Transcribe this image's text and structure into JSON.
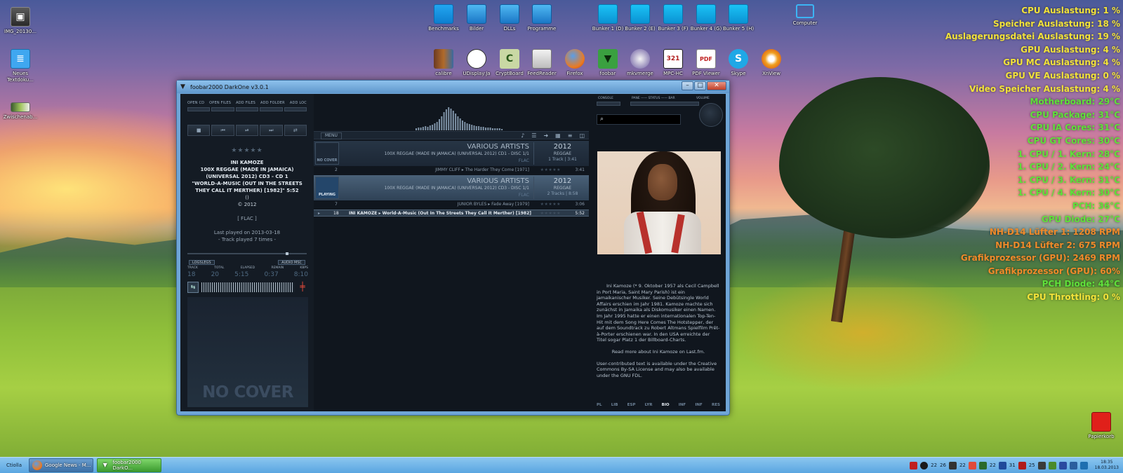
{
  "desktop": {
    "left_icons": [
      {
        "label": "IMG_20130...",
        "icon": "image-thumbnail-icon"
      },
      {
        "label": "Neues Textdoku...",
        "icon": "text-document-icon"
      },
      {
        "label": "Zwischenab...",
        "icon": "clipboard-icon"
      }
    ],
    "top_folders": [
      "Benchmarks",
      "Bilder",
      "DLLs",
      "Programme"
    ],
    "drives": [
      "Bunker 1 (D)",
      "Bunker 2 (E)",
      "Bunker 3 (F)",
      "Bunker 4 (G)",
      "Bunker 5 (H)"
    ],
    "computer": "Computer",
    "apps": [
      "calibre",
      "UDisplay:Ja",
      "CryptBoard",
      "FeedReader",
      "Firefox",
      "foobar",
      "mkvmerge",
      "MPC-HC",
      "PDF Viewer",
      "Skype",
      "XnView"
    ],
    "recycle_bin": "Papierkorb"
  },
  "sensors": [
    {
      "text": "CPU Auslastung: 1 %",
      "color": "#f2e23a"
    },
    {
      "text": "Speicher Auslastung: 18 %",
      "color": "#f2e23a"
    },
    {
      "text": "Auslagerungsdatei Auslastung: 19 %",
      "color": "#f2e23a"
    },
    {
      "text": "GPU Auslastung: 4 %",
      "color": "#f2e23a"
    },
    {
      "text": "GPU MC Auslastung: 4 %",
      "color": "#f2e23a"
    },
    {
      "text": "GPU VE Auslastung: 0 %",
      "color": "#f2e23a"
    },
    {
      "text": "Video Speicher Auslastung: 4 %",
      "color": "#f2e23a"
    },
    {
      "text": "Motherboard: 29°C",
      "color": "#5fe03a"
    },
    {
      "text": "CPU Package: 31°C",
      "color": "#5fe03a"
    },
    {
      "text": "CPU IA Cores: 31°C",
      "color": "#5fe03a"
    },
    {
      "text": "CPU GT Cores: 30°C",
      "color": "#5fe03a"
    },
    {
      "text": "1. CPU / 1. Kern: 28°C",
      "color": "#5fe03a"
    },
    {
      "text": "1. CPU / 2. Kern: 24°C",
      "color": "#5fe03a"
    },
    {
      "text": "1. CPU / 3. Kern: 31°C",
      "color": "#5fe03a"
    },
    {
      "text": "1. CPU / 4. Kern: 30°C",
      "color": "#5fe03a"
    },
    {
      "text": "PCH: 36°C",
      "color": "#5fe03a"
    },
    {
      "text": "GPU Diode: 27°C",
      "color": "#5fe03a"
    },
    {
      "text": "NH-D14 Lüfter 1: 1208 RPM",
      "color": "#f08a2a"
    },
    {
      "text": "NH-D14 Lüfter 2: 675 RPM",
      "color": "#f08a2a"
    },
    {
      "text": "Grafikprozessor (GPU): 2469 RPM",
      "color": "#f08a2a"
    },
    {
      "text": "Grafikprozessor (GPU): 60%",
      "color": "#f08a2a"
    },
    {
      "text": "PCH Diode: 44°C",
      "color": "#5fe03a"
    },
    {
      "text": "CPU Throttling: 0 %",
      "color": "#f2e23a"
    }
  ],
  "window": {
    "title": "foobar2000 DarkOne v3.0.1",
    "min": "–",
    "max": "□",
    "close": "✕",
    "toolbar_labels": [
      "OPEN CD",
      "OPEN FILES",
      "ADD FILES",
      "ADD FOLDER",
      "ADD LOC"
    ],
    "transport": [
      "■",
      "⏮",
      "⏯",
      "⏭",
      "⇄"
    ],
    "rating": "★★★★★",
    "track": {
      "artist": "INI KAMOZE",
      "album": "100X REGGAE (MADE IN JAMAICA) (UNIVERSAL 2012) CD3 - CD 1",
      "title": "\"WORLD-A-MUSIC (OUT IN THE STREETS THEY CALL IT MERTHER) [1982]\" 5:52",
      "extra": "()",
      "year": "© 2012",
      "format": "[ FLAC ]",
      "last_played": "Last played on 2013-03-18",
      "played_times": "- Track played 7 times -"
    },
    "mini_buttons": [
      "LOGSLEGS",
      "AUDIO MSC"
    ],
    "stat_labels": [
      "TRACK",
      "TOTAL",
      "ELAPSED",
      "REMAIN",
      "KBPS"
    ],
    "stat_values": [
      "18",
      "20",
      "5:15",
      "0:37",
      "8:10"
    ],
    "no_cover": "NO COVER",
    "menu_label": "MENU",
    "groups": [
      {
        "art": "NO COVER",
        "artist": "VARIOUS ARTISTS",
        "album": "100X REGGAE (MADE IN JAMAICA) (UNIVERSAL 2012) CD1 - DISC 1/1",
        "fmt": "FLAC",
        "year": "2012",
        "genre": "REGGAE",
        "count": "1 Track | 3:41"
      },
      {
        "art": "PLAYING",
        "artist": "VARIOUS ARTISTS",
        "album": "100X REGGAE (MADE IN JAMAICA) (UNIVERSAL 2012) CD3 - DISC 1/1",
        "fmt": "FLAC",
        "year": "2012",
        "genre": "REGGAE",
        "count": "2 Tracks | 8:58"
      }
    ],
    "tracks": [
      {
        "no": "2",
        "title": "JIMMY CLIFF ▸ The Harder They Come [1971]",
        "rating": "★★★★★",
        "dur": "3:41"
      },
      {
        "no": "7",
        "title": "JUNIOR BYLES ▸ Fade Away [1979]",
        "rating": "★★★★★",
        "dur": "3:06"
      },
      {
        "no": "18",
        "title": "INI KAMOZE ▸ World-A-Music (Out In The Streets They Call It Merther) [1982]",
        "rating": "★★★★★",
        "dur": "5:52",
        "selected": true
      }
    ],
    "right_labels": [
      "CONSOLE",
      "PANE —— STATUS —— BAR",
      "VOLUME"
    ],
    "search_icon": "⌕",
    "bio": [
      "Ini Kamoze (* 9. Oktober 1957 als Cecil Campbell in Port Maria, Saint Mary Parish) ist ein jamaikanischer Musiker. Seine Debütsingle World Affairs erschien im Jahr 1981. Kamoze machte sich zunächst in Jamaika als Diskomusiker einen Namen. Im Jahr 1995 hatte er einen internationalen Top-Ten-Hit mit dem Song Here Comes The Hotstepper, der auf dem Soundtrack zu Robert Altmans Spielfilm Prêt-à-Porter erschienen war. In den USA erreichte der Titel sogar Platz 1 der Billboard-Charts.",
      "Read more about Ini Kamoze on Last.fm.",
      "User-contributed text is available under the Creative Commons By-SA License and may also be available under the GNU FDL."
    ],
    "tabs": [
      "PL",
      "LIB",
      "ESP",
      "LYR",
      "BIO",
      "INF",
      "INF",
      "RES"
    ],
    "active_tab": "BIO"
  },
  "taskbar": {
    "start": "Ctiolla",
    "buttons": [
      {
        "label": "Google News - M...",
        "icon": "firefox-icon"
      },
      {
        "label": "foobar2000 DarkO...",
        "icon": "foobar-icon"
      }
    ],
    "tray_numbers": [
      "22",
      "26",
      "22",
      "22",
      "31",
      "25"
    ],
    "time": "18:35",
    "date": "18.03.2013"
  }
}
